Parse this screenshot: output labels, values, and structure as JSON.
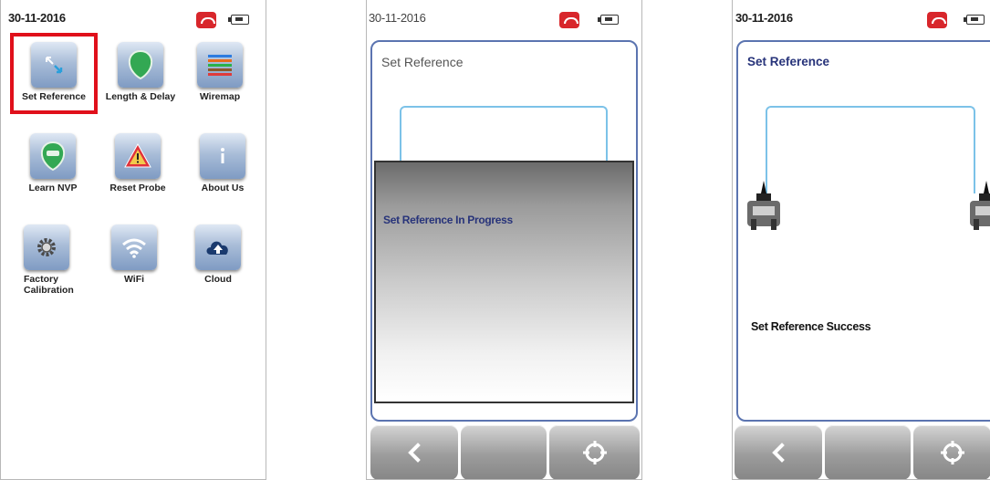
{
  "home": {
    "date": "30-11-2016",
    "apps": [
      {
        "label": "Set Reference",
        "icon": "set-reference-icon"
      },
      {
        "label": "Length & Delay",
        "icon": "length-delay-icon"
      },
      {
        "label": "Wiremap",
        "icon": "wiremap-icon"
      },
      {
        "label": "Learn NVP",
        "icon": "learn-nvp-icon"
      },
      {
        "label": "Reset Probe",
        "icon": "warning-icon"
      },
      {
        "label": "About Us",
        "icon": "info-icon"
      },
      {
        "label": "Factory Calibration",
        "icon": "gear-icon"
      },
      {
        "label": "WiFi",
        "icon": "wifi-icon"
      },
      {
        "label": "Cloud",
        "icon": "cloud-upload-icon"
      }
    ]
  },
  "progress_screen": {
    "date": "30-11-2016",
    "title": "Set Reference",
    "message": "Set Reference In Progress"
  },
  "success_screen": {
    "date": "30-11-2016",
    "title": "Set Reference",
    "message": "Set Reference Success"
  },
  "toolbar": {
    "back_icon": "chevron-left-icon",
    "target_icon": "crosshair-icon"
  },
  "colors": {
    "highlight": "#e0101b",
    "panel_border": "#5b74b0",
    "title_blue": "#27337a",
    "cable": "#7cc2e8",
    "phone_red": "#d8262b"
  }
}
